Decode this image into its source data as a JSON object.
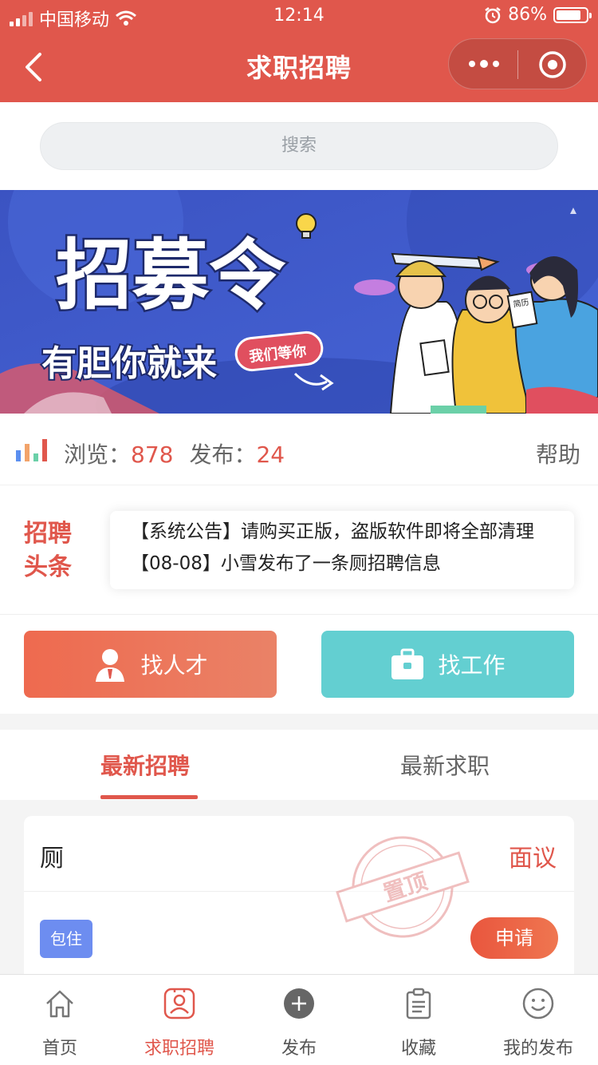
{
  "status_bar": {
    "carrier": "中国移动",
    "time": "12:14",
    "battery": "86%"
  },
  "nav": {
    "title": "求职招聘"
  },
  "search": {
    "placeholder": "搜索"
  },
  "banner": {
    "title": "招募令",
    "subtitle": "有胆你就来",
    "badge": "我们等你",
    "poster_text": "简历"
  },
  "stats": {
    "views_label": "浏览：",
    "views": "878",
    "posts_label": "发布：",
    "posts": "24",
    "help": "帮助"
  },
  "headlines": {
    "label_line1": "招聘",
    "label_line2": "头条",
    "items": [
      "【系统公告】请购买正版，盗版软件即将全部清理",
      "【08-08】小雪发布了一条厕招聘信息"
    ]
  },
  "finds": {
    "talent": "找人才",
    "job": "找工作"
  },
  "tabs": {
    "recruit": "最新招聘",
    "seek": "最新求职"
  },
  "job": {
    "title": "厕",
    "salary": "面议",
    "tag": "包住",
    "apply": "申请",
    "stamp": "置顶"
  },
  "tabbar": {
    "home": "首页",
    "jobs": "求职招聘",
    "publish": "发布",
    "favorites": "收藏",
    "my_posts": "我的发布"
  },
  "colors": {
    "primary": "#e0574c",
    "teal": "#63cfd1",
    "tag_blue": "#6d8df0",
    "banner_blue": "#3f56c4"
  }
}
